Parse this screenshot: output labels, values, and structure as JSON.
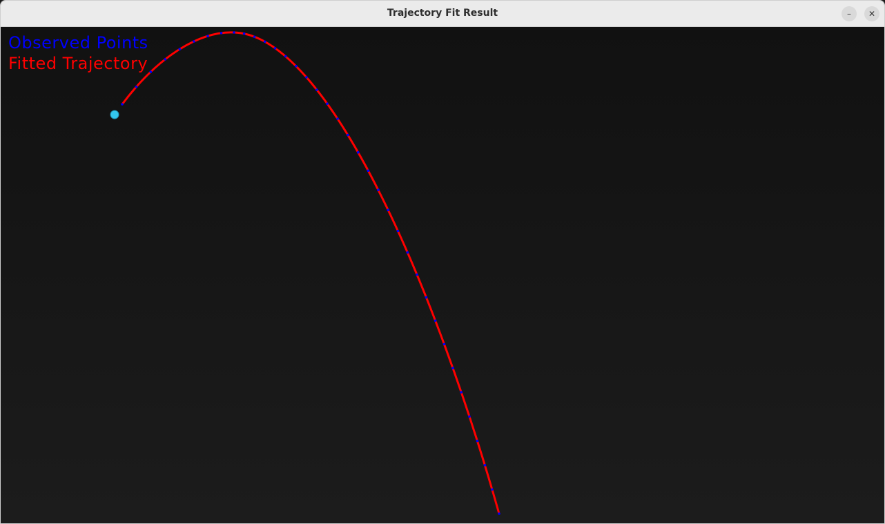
{
  "window": {
    "title": "Trajectory Fit Result",
    "minimize_glyph": "–",
    "close_glyph": "✕"
  },
  "legend": {
    "observed_label": "Observed Points",
    "fitted_label": "Fitted Trajectory"
  },
  "colors": {
    "observed": "#0000ff",
    "fitted": "#ff0000",
    "start_marker": "#33c6ee",
    "background": "#161616"
  },
  "icons": [
    "minimize-icon",
    "close-icon"
  ]
}
